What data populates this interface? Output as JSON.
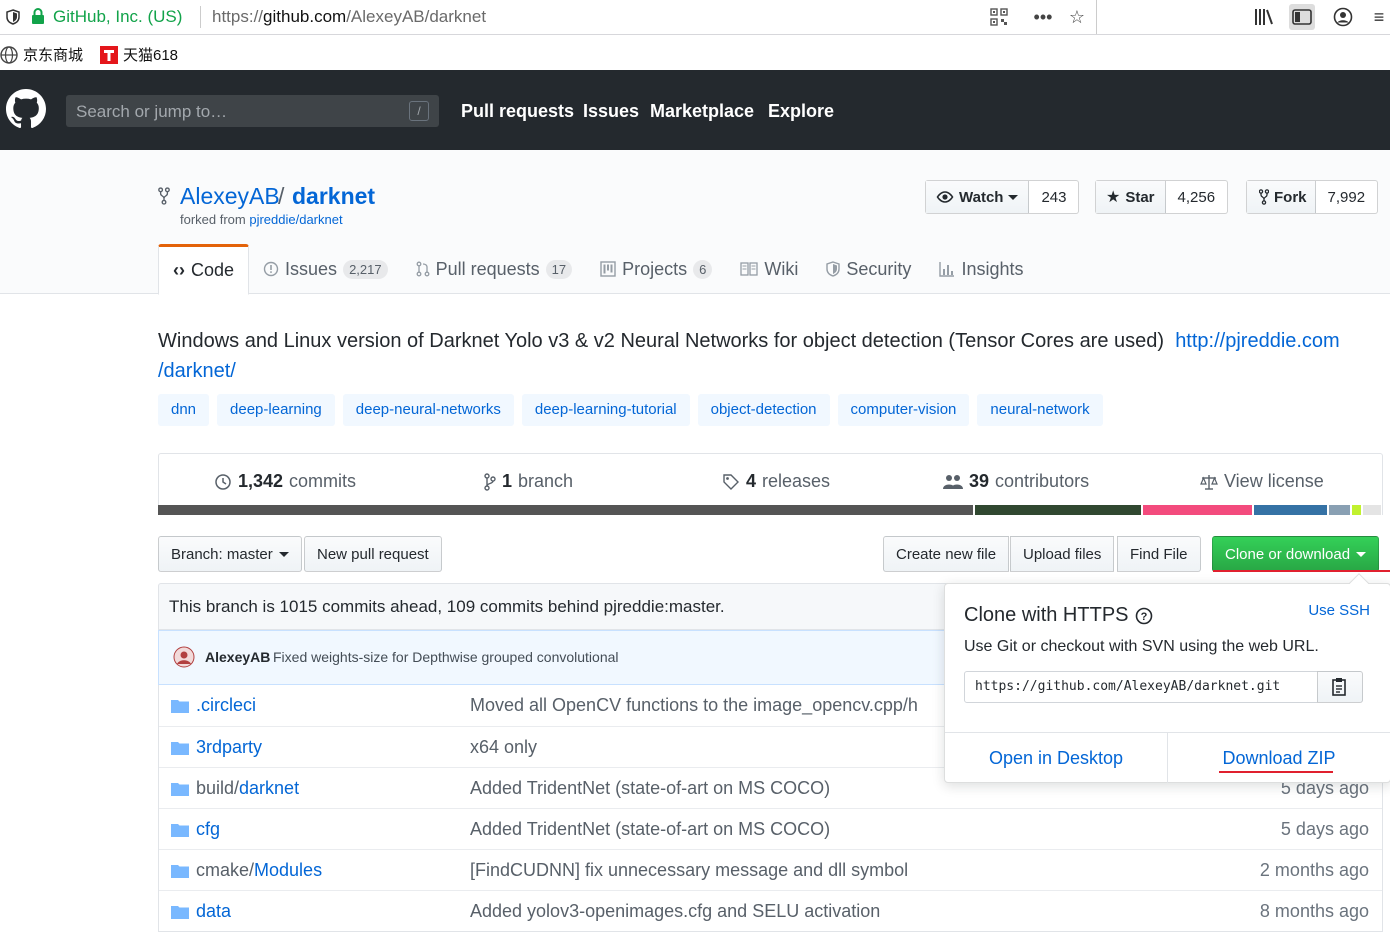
{
  "browser": {
    "site_identity": "GitHub, Inc. (US)",
    "url_prefix": "https://",
    "url_host": "github.com",
    "url_path": "/AlexeyAB/darknet",
    "bookmarks": [
      {
        "label": "京东商城",
        "icon": "globe-icon"
      },
      {
        "label": "天猫618",
        "icon": "tmall-icon"
      }
    ]
  },
  "github_header": {
    "search_placeholder": "Search or jump to…",
    "search_shortcut": "/",
    "nav": [
      "Pull requests",
      "Issues",
      "Marketplace",
      "Explore"
    ]
  },
  "repo": {
    "owner": "AlexeyAB",
    "separator": "/",
    "name": "darknet",
    "forked_prefix": "forked from ",
    "forked_from": "pjreddie/darknet",
    "watch": {
      "label": "Watch",
      "count": "243"
    },
    "star": {
      "label": "Star",
      "count": "4,256"
    },
    "fork": {
      "label": "Fork",
      "count": "7,992"
    }
  },
  "tabs": [
    {
      "label": "Code",
      "count": "",
      "icon": "code-icon"
    },
    {
      "label": "Issues",
      "count": "2,217",
      "icon": "issue-icon"
    },
    {
      "label": "Pull requests",
      "count": "17",
      "icon": "pr-icon"
    },
    {
      "label": "Projects",
      "count": "6",
      "icon": "project-icon"
    },
    {
      "label": "Wiki",
      "count": "",
      "icon": "book-icon"
    },
    {
      "label": "Security",
      "count": "",
      "icon": "shield-icon"
    },
    {
      "label": "Insights",
      "count": "",
      "icon": "graph-icon"
    }
  ],
  "description": {
    "text": "Windows and Linux version of Darknet Yolo v3 & v2 Neural Networks for object detection (Tensor Cores are used)",
    "link_line1": "http://pjreddie.com",
    "link_line2": "/darknet/"
  },
  "topics": [
    "dnn",
    "deep-learning",
    "deep-neural-networks",
    "deep-learning-tutorial",
    "object-detection",
    "computer-vision",
    "neural-network"
  ],
  "stats": {
    "commits_num": "1,342",
    "commits_label": "commits",
    "branch_num": "1",
    "branch_label": "branch",
    "releases_num": "4",
    "releases_label": "releases",
    "contributors_num": "39",
    "contributors_label": "contributors",
    "license_label": "View license"
  },
  "language_bar_colors": [
    "#555555",
    "#304830",
    "#f34b7d",
    "#3572a5",
    "#89a0b3",
    "#c1f12e",
    "#e4e4e4"
  ],
  "language_bar_shares": [
    0.673,
    0.137,
    0.09,
    0.06,
    0.018,
    0.007,
    0.015
  ],
  "toolbar": {
    "branch_label": "Branch: master",
    "new_pr": "New pull request",
    "create_file": "Create new file",
    "upload_files": "Upload files",
    "find_file": "Find File",
    "clone_download": "Clone or download"
  },
  "ahead_behind": "This branch is 1015 commits ahead, 109 commits behind pjreddie:master.",
  "latest_commit": {
    "author": "AlexeyAB",
    "message": "Fixed weights-size for Depthwise grouped convolutional"
  },
  "files": [
    {
      "prefix": "",
      "name": ".circleci",
      "message": "Moved all OpenCV functions to the image_opencv.cpp/h",
      "age": ""
    },
    {
      "prefix": "",
      "name": "3rdparty",
      "message": "x64 only",
      "age": ""
    },
    {
      "prefix": "build/",
      "name": "darknet",
      "message": "Added TridentNet (state-of-art on MS COCO)",
      "age": "5 days ago"
    },
    {
      "prefix": "",
      "name": "cfg",
      "message": "Added TridentNet (state-of-art on MS COCO)",
      "age": "5 days ago"
    },
    {
      "prefix": "cmake/",
      "name": "Modules",
      "message": "[FindCUDNN] fix unnecessary message and dll symbol",
      "age": "2 months ago"
    },
    {
      "prefix": "",
      "name": "data",
      "message": "Added yolov3-openimages.cfg and SELU activation",
      "age": "8 months ago"
    }
  ],
  "clone_popup": {
    "title": "Clone with HTTPS",
    "use_ssh": "Use SSH",
    "hint": "Use Git or checkout with SVN using the web URL.",
    "url": "https://github.com/AlexeyAB/darknet.git",
    "open_desktop": "Open in Desktop",
    "download_zip": "Download ZIP"
  }
}
